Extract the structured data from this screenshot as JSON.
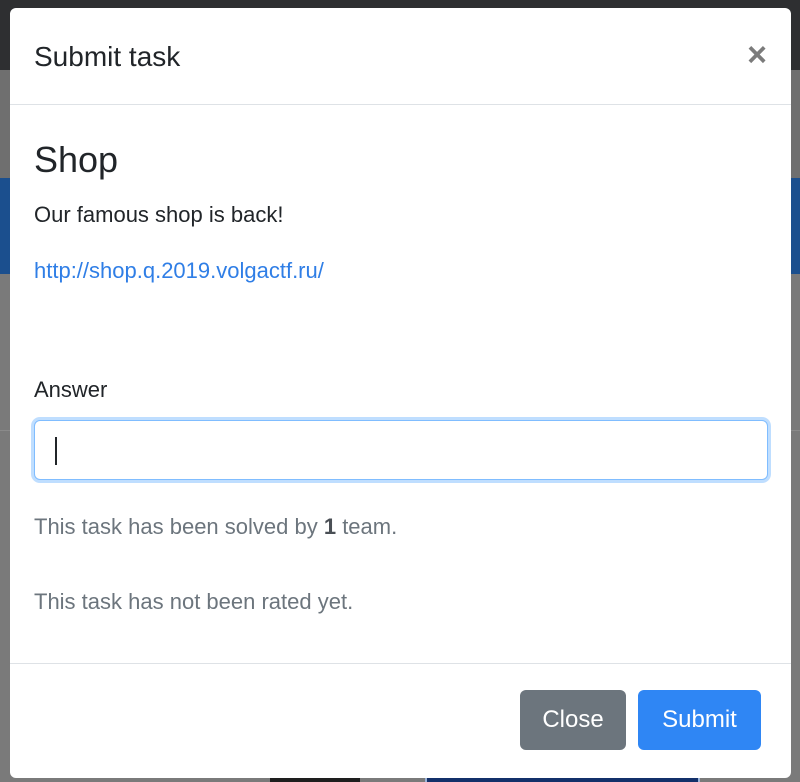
{
  "modal": {
    "title": "Submit task",
    "close_icon_glyph": "×"
  },
  "task": {
    "title": "Shop",
    "description": "Our famous shop is back!",
    "link": "http://shop.q.2019.volgactf.ru/"
  },
  "answer": {
    "label": "Answer",
    "value": "",
    "placeholder": ""
  },
  "stats": {
    "solved_prefix": "This task has been solved by ",
    "solved_count": "1",
    "solved_suffix": " team.",
    "rating": "This task has not been rated yet."
  },
  "footer": {
    "close_label": "Close",
    "submit_label": "Submit"
  },
  "colors": {
    "link": "#2f7ee6",
    "close_button": "#6c757d",
    "submit_button": "#2f86f4",
    "input_focus": "#80bdff"
  }
}
